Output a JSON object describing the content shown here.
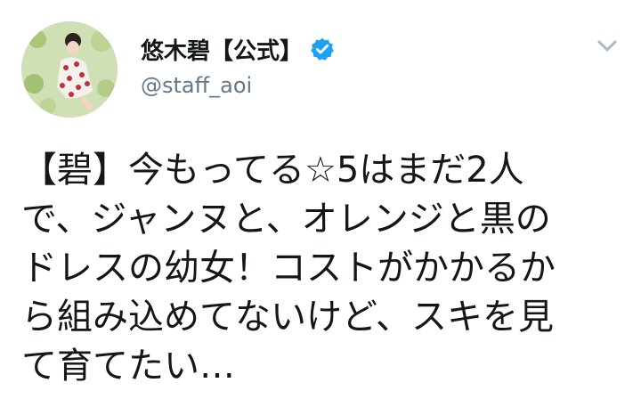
{
  "author": {
    "display_name": "悠木碧【公式】",
    "handle": "@staff_aoi",
    "verified": true,
    "avatar": "profile-photo"
  },
  "menu": {
    "icon": "chevron-down-icon"
  },
  "tweet": {
    "lines": [
      "【碧】今もってる☆5はまだ2人",
      "で、ジャンヌと、オレンジと黒の",
      "ドレスの幼女！コストがかかるか",
      "ら組み込めてないけど、スキを見",
      "て育てたい…"
    ]
  },
  "colors": {
    "verified_blue": "#1da1f2",
    "text_primary": "#14171a",
    "text_secondary": "#657786",
    "caret_gray": "#aab8c2"
  }
}
